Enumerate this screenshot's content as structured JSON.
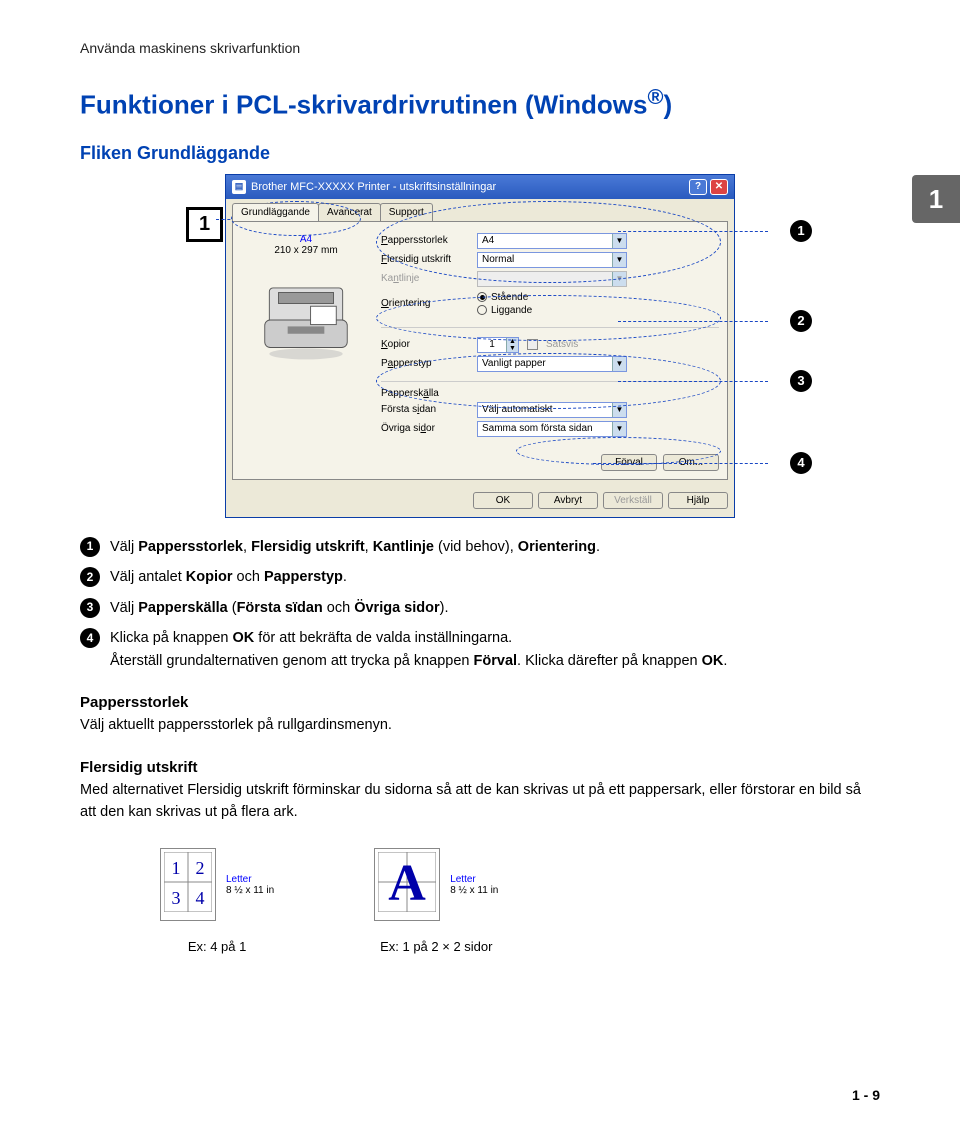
{
  "header": "Använda maskinens skrivarfunktion",
  "title_prefix": "Funktioner i PCL-skrivardrivrutinen (Windows",
  "title_reg": "®",
  "title_suffix": ")",
  "subtitle": "Fliken Grundläggande",
  "section_num": "1",
  "left_callout": "1",
  "dialog": {
    "title": "Brother MFC-XXXXX Printer  -  utskriftsinställningar",
    "tabs": [
      "Grundläggande",
      "Avancerat",
      "Support"
    ],
    "preview_size": "A4",
    "preview_dim": "210 x 297 mm",
    "labels": {
      "pappersstorlek": "Pappersstorlek",
      "flersidig": "Flersidig utskrift",
      "kantlinje": "Kantlinje",
      "orientering": "Orientering",
      "staende": "Stående",
      "liggande": "Liggande",
      "kopior": "Kopior",
      "satsvis": "Satsvis",
      "papperstyp": "Papperstyp",
      "papperskalla": "Papperskälla",
      "forsta_sidan": "Första sidan",
      "ovriga_sidor": "Övriga sidor"
    },
    "values": {
      "pappersstorlek": "A4",
      "flersidig": "Normal",
      "kopior": "1",
      "papperstyp": "Vanligt papper",
      "forsta_sidan": "Välj automatiskt",
      "ovriga_sidor": "Samma som första sidan",
      "forval": "Förval",
      "om": "Om...",
      "ok": "OK",
      "avbryt": "Avbryt",
      "verkstall": "Verkställ",
      "hjalp": "Hjälp"
    }
  },
  "callouts": {
    "c1": "1",
    "c2": "2",
    "c3": "3",
    "c4": "4"
  },
  "list": [
    {
      "num": "1",
      "html": "Välj <b>Pappersstorlek</b>, <b>Flersidig utskrift</b>, <b>Kantlinje</b> (vid behov), <b>Orientering</b>."
    },
    {
      "num": "2",
      "html": "Välj antalet <b>Kopior</b> och <b>Papperstyp</b>."
    },
    {
      "num": "3",
      "html": "Välj <b>Papperskälla</b> (<b>Första sïdan</b> och <b>Övriga sidor</b>)."
    },
    {
      "num": "4",
      "html": "Klicka på knappen <b>OK</b> för att bekräfta de valda inställningarna.<br>Återställ grundalternativen genom att trycka på knappen <b>Förval</b>. Klicka därefter på knappen <b>OK</b>."
    }
  ],
  "pappersstorlek": {
    "head": "Pappersstorlek",
    "body": "Välj aktuellt pappersstorlek på rullgardinsmenyn."
  },
  "flersidig": {
    "head": "Flersidig utskrift",
    "body": "Med alternativet Flersidig utskrift förminskar du sidorna så att de kan skrivas ut på ett pappersark, eller förstorar en bild så att den kan skrivas ut på flera ark."
  },
  "examples": {
    "letter_lbl": "Letter",
    "letter_dim": "8 ½ x 11 in",
    "cap1": "Ex: 4 på 1",
    "cap2": "Ex: 1 på 2 × 2 sidor"
  },
  "footer": "1 - 9"
}
